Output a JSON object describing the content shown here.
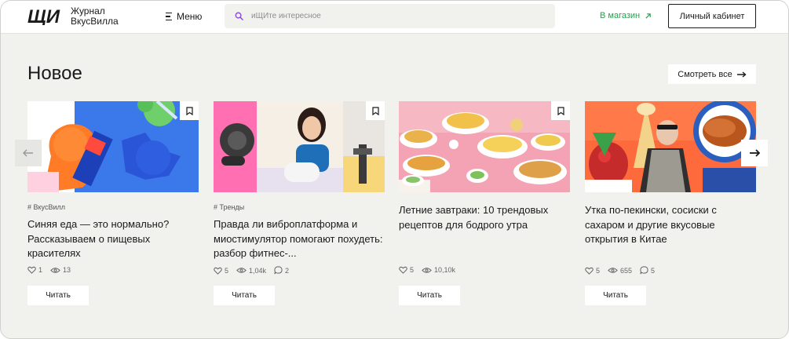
{
  "header": {
    "logo_mark": "ЩИ",
    "logo_line1": "Журнал",
    "logo_line2": "ВкусВилла",
    "menu_label": "Меню",
    "search_placeholder": "иЩИте интересное",
    "shop_link": "В магазин",
    "cabinet_button": "Личный кабинет"
  },
  "section": {
    "title": "Новое",
    "see_all": "Смотреть все"
  },
  "colors": {
    "accent_green": "#1fa34a",
    "search_icon": "#8a4fd6",
    "background": "#f1f1ee"
  },
  "cards": [
    {
      "tag": "# ВкусВилл",
      "title": "Синяя еда — это нормально? Рассказываем о пищевых красителях",
      "likes": "1",
      "views": "13",
      "comments": "",
      "read": "Читать"
    },
    {
      "tag": "# Тренды",
      "title": "Правда ли виброплатформа и миостимулятор помогают похудеть: разбор фитнес-...",
      "likes": "5",
      "views": "1,04k",
      "comments": "2",
      "read": "Читать"
    },
    {
      "tag": "",
      "title": "Летние завтраки: 10 трендовых рецептов для бодрого утра",
      "likes": "5",
      "views": "10,10k",
      "comments": "",
      "read": "Читать"
    },
    {
      "tag": "",
      "title": "Утка по-пекински, сосиски с сахаром и другие вкусовые открытия в Китае",
      "likes": "5",
      "views": "655",
      "comments": "5",
      "read": "Читать"
    }
  ]
}
